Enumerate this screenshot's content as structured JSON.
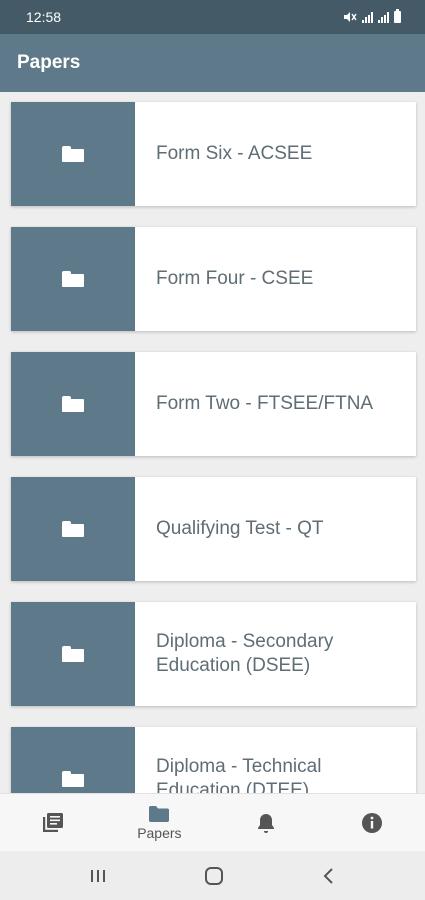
{
  "status_bar": {
    "time": "12:58"
  },
  "app_bar": {
    "title": "Papers"
  },
  "papers": [
    {
      "label": "Form Six - ACSEE"
    },
    {
      "label": "Form Four - CSEE"
    },
    {
      "label": "Form Two - FTSEE/FTNA"
    },
    {
      "label": "Qualifying Test - QT"
    },
    {
      "label": "Diploma - Secondary Education (DSEE)"
    },
    {
      "label": "Diploma - Technical Education (DTEE)"
    }
  ],
  "bottom_nav": {
    "items": [
      {
        "icon": "library-icon",
        "label": ""
      },
      {
        "icon": "folder-icon",
        "label": "Papers"
      },
      {
        "icon": "bell-icon",
        "label": ""
      },
      {
        "icon": "info-icon",
        "label": ""
      }
    ],
    "active_index": 1
  },
  "colors": {
    "status_bar": "#445a67",
    "accent": "#5e7a8a",
    "card_text": "#5f6d75",
    "background": "#eeeeee"
  }
}
